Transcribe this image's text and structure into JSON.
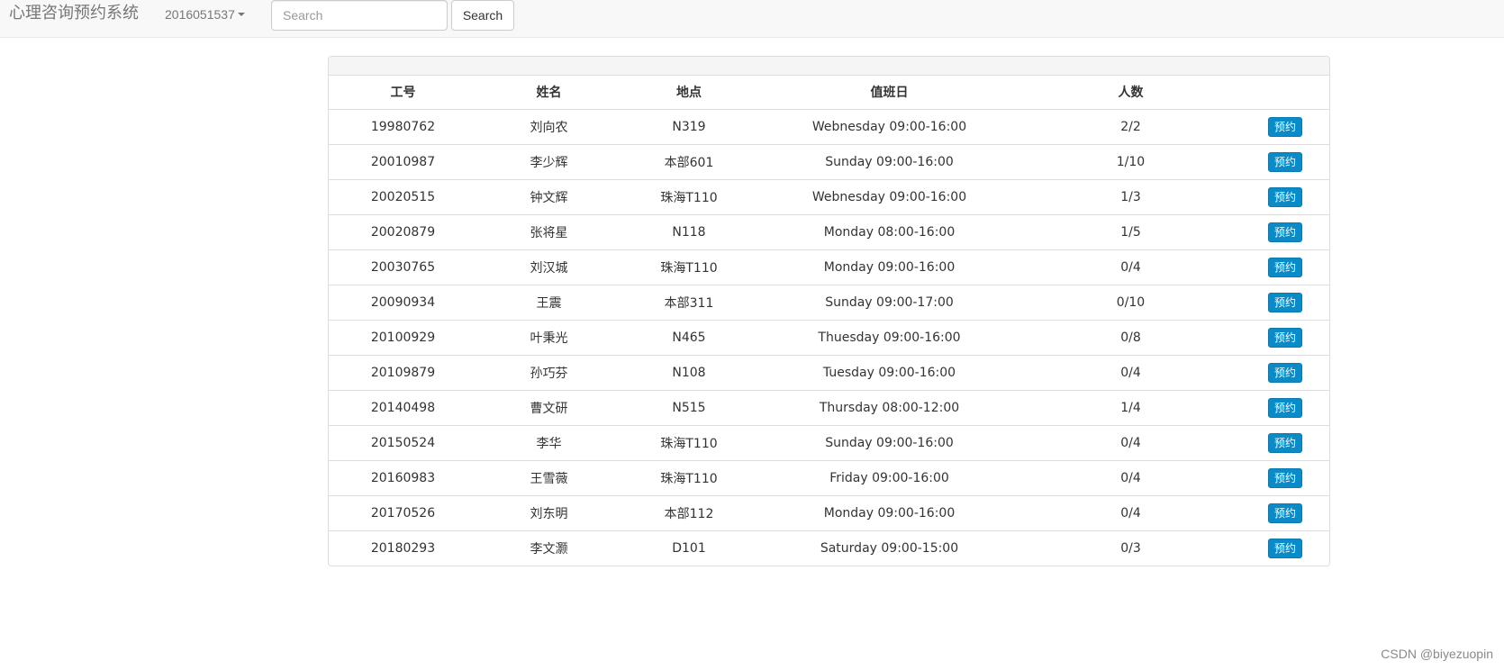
{
  "navbar": {
    "brand": "心理咨询预约系统",
    "user": "2016051537",
    "search_placeholder": "Search",
    "search_button": "Search"
  },
  "table": {
    "headers": [
      "工号",
      "姓名",
      "地点",
      "值班日",
      "人数",
      ""
    ],
    "rows": [
      {
        "id": "19980762",
        "name": "刘向农",
        "location": "N319",
        "duty": "Webnesday 09:00-16:00",
        "count": "2/2",
        "action": "预约"
      },
      {
        "id": "20010987",
        "name": "李少辉",
        "location": "本部601",
        "duty": "Sunday 09:00-16:00",
        "count": "1/10",
        "action": "预约"
      },
      {
        "id": "20020515",
        "name": "钟文辉",
        "location": "珠海T110",
        "duty": "Webnesday 09:00-16:00",
        "count": "1/3",
        "action": "预约"
      },
      {
        "id": "20020879",
        "name": "张将星",
        "location": "N118",
        "duty": "Monday 08:00-16:00",
        "count": "1/5",
        "action": "预约"
      },
      {
        "id": "20030765",
        "name": "刘汉城",
        "location": "珠海T110",
        "duty": "Monday 09:00-16:00",
        "count": "0/4",
        "action": "预约"
      },
      {
        "id": "20090934",
        "name": "王震",
        "location": "本部311",
        "duty": "Sunday 09:00-17:00",
        "count": "0/10",
        "action": "预约"
      },
      {
        "id": "20100929",
        "name": "叶秉光",
        "location": "N465",
        "duty": "Thuesday 09:00-16:00",
        "count": "0/8",
        "action": "预约"
      },
      {
        "id": "20109879",
        "name": "孙巧芬",
        "location": "N108",
        "duty": "Tuesday 09:00-16:00",
        "count": "0/4",
        "action": "预约"
      },
      {
        "id": "20140498",
        "name": "曹文研",
        "location": "N515",
        "duty": "Thursday 08:00-12:00",
        "count": "1/4",
        "action": "预约"
      },
      {
        "id": "20150524",
        "name": "李华",
        "location": "珠海T110",
        "duty": "Sunday 09:00-16:00",
        "count": "0/4",
        "action": "预约"
      },
      {
        "id": "20160983",
        "name": "王雪薇",
        "location": "珠海T110",
        "duty": "Friday 09:00-16:00",
        "count": "0/4",
        "action": "预约"
      },
      {
        "id": "20170526",
        "name": "刘东明",
        "location": "本部112",
        "duty": "Monday 09:00-16:00",
        "count": "0/4",
        "action": "预约"
      },
      {
        "id": "20180293",
        "name": "李文灏",
        "location": "D101",
        "duty": "Saturday 09:00-15:00",
        "count": "0/3",
        "action": "预约"
      }
    ]
  },
  "watermark": "CSDN @biyezuopin",
  "colors": {
    "navbar_bg": "#f8f8f8",
    "book_button": "#0a8ac6",
    "border": "#dddddd"
  }
}
